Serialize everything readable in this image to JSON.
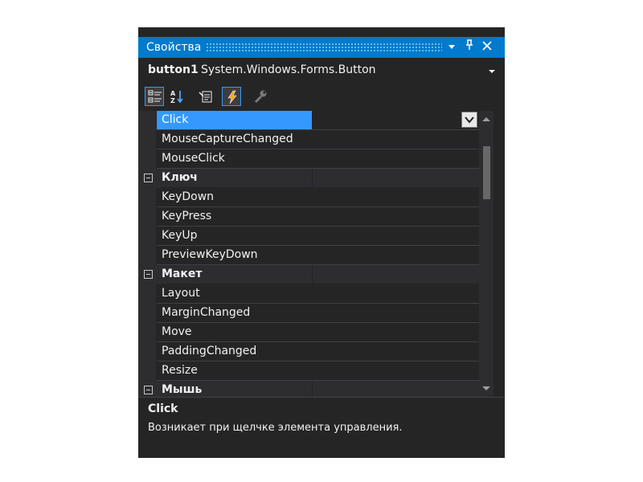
{
  "window": {
    "title": "Свойства",
    "pin_icon": "pin-icon",
    "close_icon": "close-icon",
    "dropdown_icon": "window-position-dropdown-icon"
  },
  "object_selector": {
    "name": "button1",
    "type": "System.Windows.Forms.Button"
  },
  "toolbar": {
    "buttons": [
      {
        "icon": "categorized-icon",
        "active": true
      },
      {
        "icon": "alphabetical-icon",
        "active": false
      },
      {
        "icon": "properties-icon",
        "active": false
      },
      {
        "icon": "events-lightning-icon",
        "active": true
      },
      {
        "icon": "property-pages-wrench-icon",
        "active": false
      }
    ]
  },
  "grid": {
    "rows": [
      {
        "kind": "item",
        "label": "Click",
        "selected": true
      },
      {
        "kind": "item",
        "label": "MouseCaptureChanged"
      },
      {
        "kind": "item",
        "label": "MouseClick"
      },
      {
        "kind": "category",
        "label": "Ключ"
      },
      {
        "kind": "item",
        "label": "KeyDown"
      },
      {
        "kind": "item",
        "label": "KeyPress"
      },
      {
        "kind": "item",
        "label": "KeyUp"
      },
      {
        "kind": "item",
        "label": "PreviewKeyDown"
      },
      {
        "kind": "category",
        "label": "Макет"
      },
      {
        "kind": "item",
        "label": "Layout"
      },
      {
        "kind": "item",
        "label": "MarginChanged"
      },
      {
        "kind": "item",
        "label": "Move"
      },
      {
        "kind": "item",
        "label": "PaddingChanged"
      },
      {
        "kind": "item",
        "label": "Resize"
      },
      {
        "kind": "category",
        "label": "Мышь"
      }
    ]
  },
  "description": {
    "title": "Click",
    "text": "Возникает при щелчке элемента управления."
  },
  "colors": {
    "accent": "#007acc",
    "selection": "#3399ff",
    "background": "#252526",
    "category_background": "#2d2d30"
  }
}
